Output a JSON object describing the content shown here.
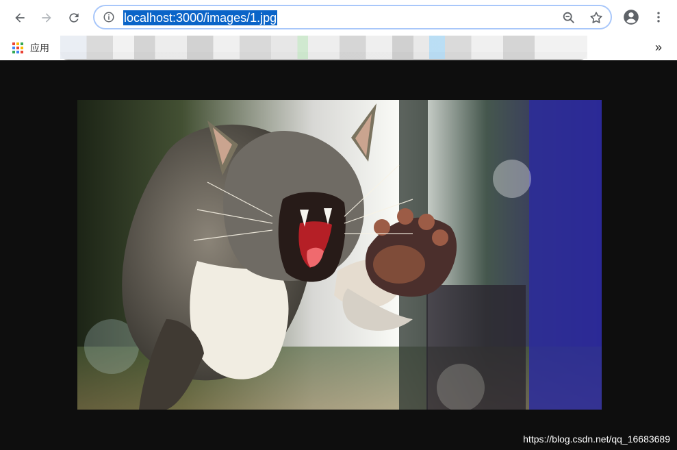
{
  "browser": {
    "url": "localhost:3000/images/1.jpg",
    "icons": {
      "back": "arrow-left-icon",
      "forward": "arrow-right-icon",
      "reload": "reload-icon",
      "site_info": "info-icon",
      "zoom": "zoom-out-icon",
      "bookmark": "star-icon",
      "profile": "account-circle-icon",
      "menu": "more-vert-icon"
    }
  },
  "bookmarks_bar": {
    "apps_label": "应用",
    "overflow_label": "»"
  },
  "page": {
    "background_color": "#0e0e0e",
    "watermark": "https://blog.csdn.net/qq_16683689"
  }
}
